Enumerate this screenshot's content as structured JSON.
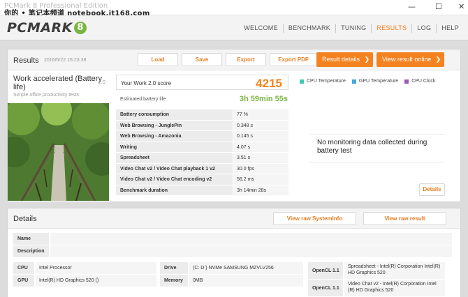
{
  "window": {
    "title": "PCMark 8 Professional Edition",
    "watermark": "你的 • 笔记本频道 notebook.it168.com",
    "controls": [
      "—",
      "☐",
      "✕"
    ]
  },
  "header": {
    "logo_text": "PCMARK",
    "logo_badge": "8",
    "nav": [
      "WELCOME",
      "BENCHMARK",
      "TUNING",
      "RESULTS",
      "LOG",
      "HELP"
    ],
    "active_nav": "RESULTS"
  },
  "results": {
    "title": "Results",
    "date": "2016/6/22 16:23:38",
    "buttons": {
      "load": "Load",
      "save": "Save",
      "export": "Export",
      "export_pdf": "Export PDF",
      "result_details": "Result details",
      "view_online": "View result online"
    },
    "test": {
      "name": "Work accelerated (Battery life)",
      "version": "2.0",
      "subtitle": "Simple office productivity tests"
    },
    "score": {
      "label": "Your Work 2.0 score",
      "value": "4215"
    },
    "battery": {
      "label": "Estimated battery life",
      "value": "3h 59min 55s"
    },
    "metrics": [
      {
        "label": "Battery consumption",
        "value": "77 %"
      },
      {
        "label": "Web Browsing - JunglePin",
        "value": "0.348 s"
      },
      {
        "label": "Web Browsing - Amazonia",
        "value": "0.145 s"
      },
      {
        "label": "Writing",
        "value": "4.07 s"
      },
      {
        "label": "Spreadsheet",
        "value": "3.51 s"
      },
      {
        "label": "Video Chat v2 / Video Chat playback 1 v2",
        "value": "30.0 fps"
      },
      {
        "label": "Video Chat v2 / Video Chat encoding v2",
        "value": "56.2 ms"
      },
      {
        "label": "Benchmark duration",
        "value": "3h 14min 28s"
      }
    ],
    "monitoring": {
      "legend": [
        {
          "label": "CPU Temperature",
          "color": "#3fc8b4"
        },
        {
          "label": "GPU Temperature",
          "color": "#3fa8d8"
        },
        {
          "label": "CPU Clock",
          "color": "#9b59b6"
        }
      ],
      "message": "No monitoring data collected during battery test",
      "details_button": "Details"
    }
  },
  "details": {
    "title": "Details",
    "view_systeminfo": "View raw SystemInfo",
    "view_result": "View raw result",
    "name_label": "Name",
    "name_value": "",
    "description_label": "Description",
    "description_value": "",
    "cpu_label": "CPU",
    "cpu_value": "Intel Processor",
    "gpu_label": "GPU",
    "gpu_value": "Intel(R) HD Graphics 520 ()",
    "drive_label": "Drive",
    "drive_value": "(C: D:) NVMe SAMSUNG MZVLV256",
    "memory_label": "Memory",
    "memory_value": "0MB",
    "opencl": [
      {
        "label": "OpenCL 1.1",
        "value": "Spreadsheet - Intel(R) Corporation Intel(R) HD Graphics 520"
      },
      {
        "label": "OpenCL 1.1",
        "value": "Video Chat v2 - Intel(R) Corporation Intel (R) HD Graphics 520"
      }
    ]
  }
}
